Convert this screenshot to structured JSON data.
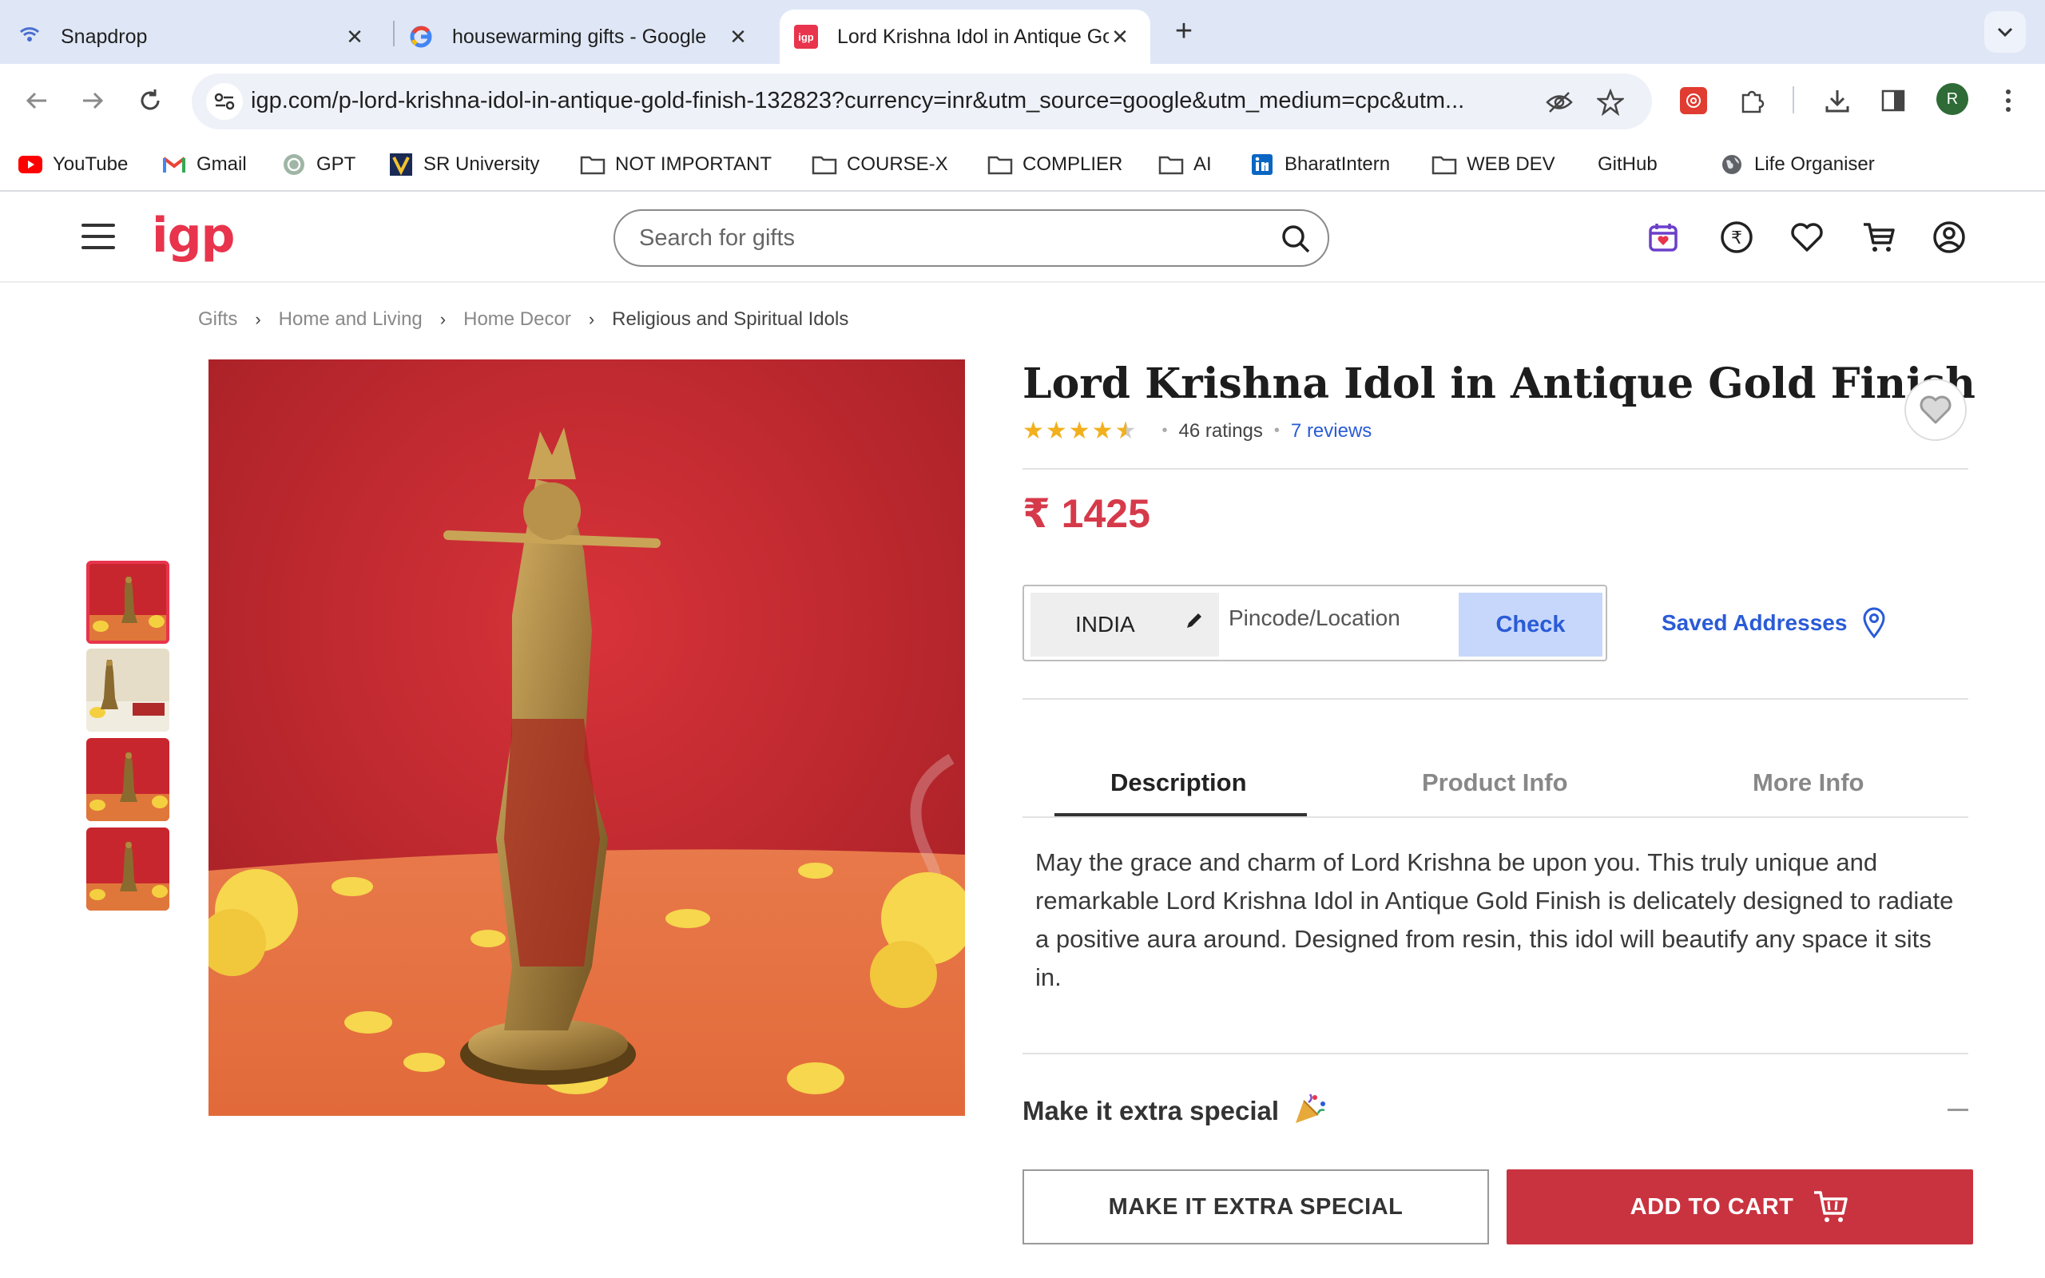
{
  "browser": {
    "tabs": [
      {
        "title": "Snapdrop",
        "icon": "wifi-icon"
      },
      {
        "title": "housewarming gifts - Google",
        "icon": "google-icon"
      },
      {
        "title": "Lord Krishna Idol in Antique Gold Finish",
        "icon": "igp-icon",
        "active": true
      }
    ],
    "favicon_label": "igp",
    "url": "igp.com/p-lord-krishna-idol-in-antique-gold-finish-132823?currency=inr&utm_source=google&utm_medium=cpc&utm...",
    "profile_initial": "R",
    "bookmarks": [
      {
        "label": "YouTube",
        "icon": "youtube-icon"
      },
      {
        "label": "Gmail",
        "icon": "gmail-icon"
      },
      {
        "label": "GPT",
        "icon": "openai-icon"
      },
      {
        "label": "SR University",
        "icon": "sr-university-icon"
      },
      {
        "label": "NOT IMPORTANT",
        "icon": "folder-icon"
      },
      {
        "label": "COURSE-X",
        "icon": "folder-icon"
      },
      {
        "label": "COMPLIER",
        "icon": "folder-icon"
      },
      {
        "label": "AI",
        "icon": "folder-icon"
      },
      {
        "label": "BharatIntern",
        "icon": "linkedin-icon"
      },
      {
        "label": "WEB DEV",
        "icon": "folder-icon"
      },
      {
        "label": "GitHub",
        "icon": "github-icon"
      },
      {
        "label": "Life Organiser",
        "icon": "globe-icon"
      }
    ]
  },
  "site": {
    "logo": "igp",
    "search_placeholder": "Search for gifts",
    "brand_color": "#e8344c"
  },
  "breadcrumb": [
    "Gifts",
    "Home and Living",
    "Home Decor",
    "Religious and Spiritual Idols"
  ],
  "product": {
    "title": "Lord Krishna Idol in Antique Gold Finish",
    "stars": "★★★★",
    "half_star": "★",
    "rating_value": 4.5,
    "ratings": "46 ratings",
    "reviews": "7 reviews",
    "price": "₹ 1425",
    "thumbnail_count": 4
  },
  "delivery": {
    "country": "INDIA",
    "pin_placeholder": "Pincode/Location",
    "check_label": "Check",
    "saved_addresses": "Saved Addresses"
  },
  "info_tabs": [
    {
      "label": "Description",
      "active": true
    },
    {
      "label": "Product Info"
    },
    {
      "label": "More Info"
    }
  ],
  "description": "May the grace and charm of Lord Krishna be upon you. This truly unique and remarkable Lord Krishna Idol in Antique Gold Finish is delicately designed to radiate a positive aura around. Designed from resin, this idol will beautify any space it sits in.",
  "extra_special": {
    "title": "Make it extra special"
  },
  "actions": {
    "extra_special_button": "MAKE IT EXTRA SPECIAL",
    "add_to_cart_button": "ADD TO CART"
  }
}
